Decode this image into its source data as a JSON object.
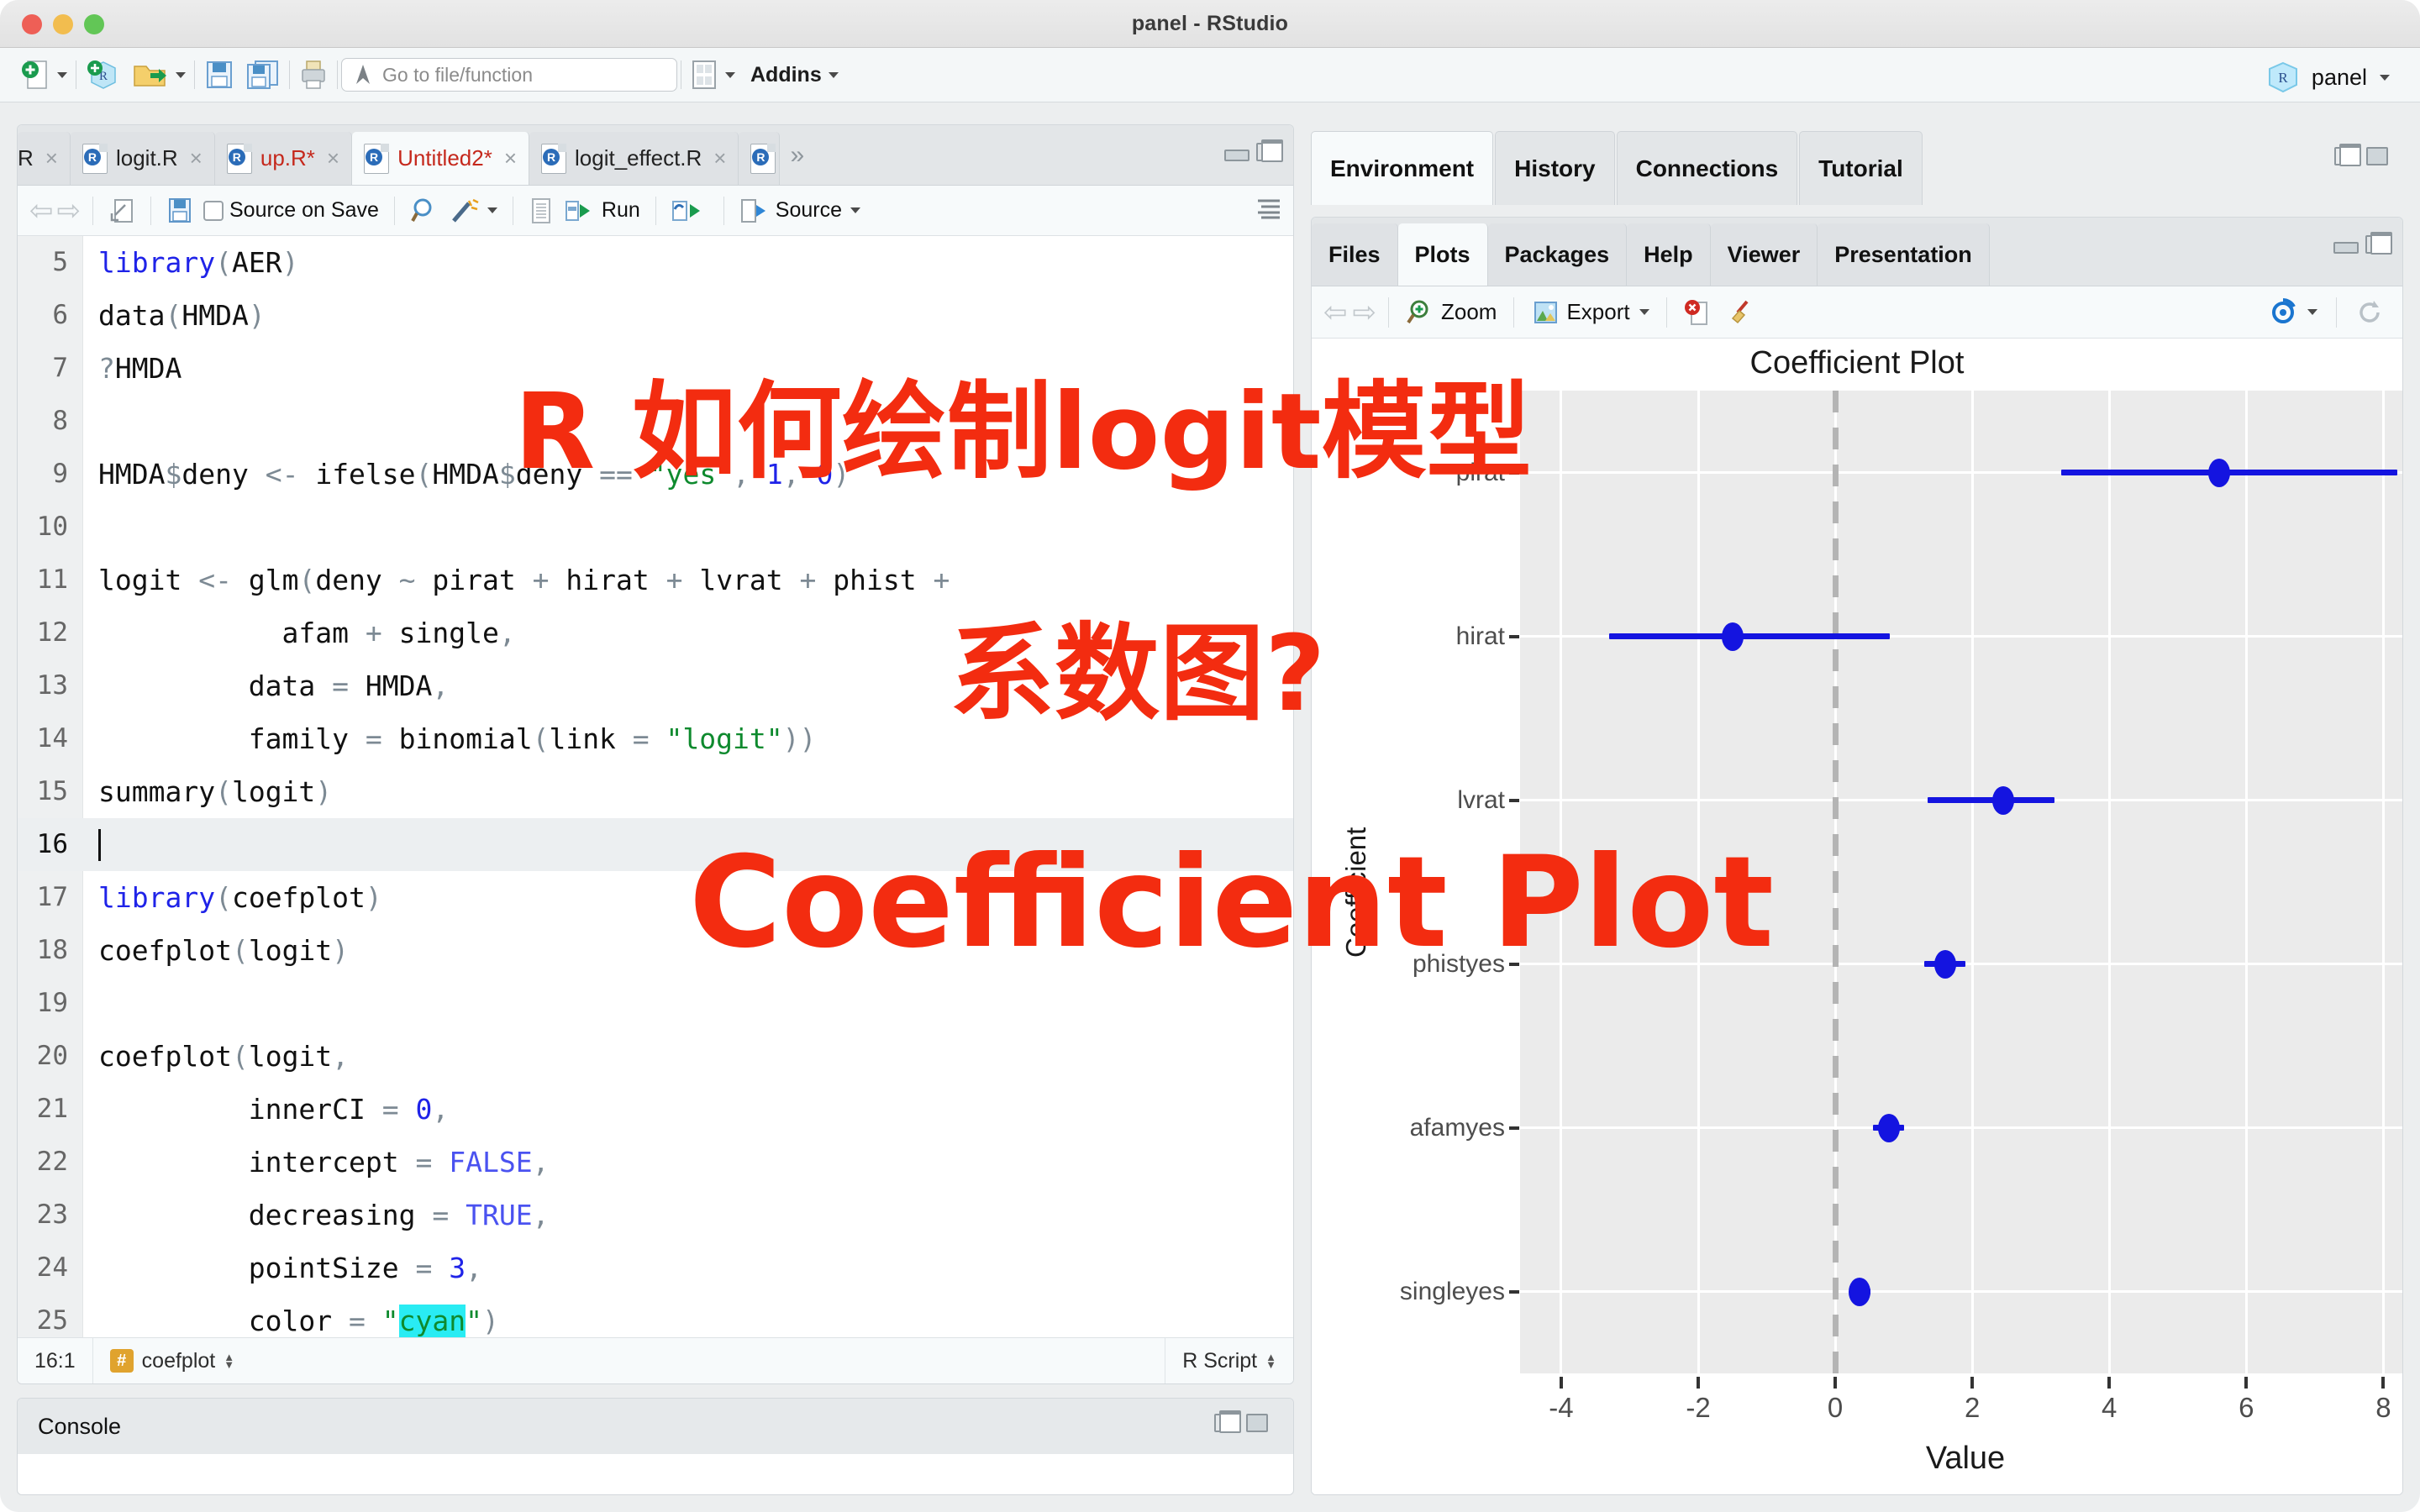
{
  "window": {
    "title": "panel - RStudio"
  },
  "toolbar": {
    "goto_placeholder": "Go to file/function",
    "addins_label": "Addins",
    "project_name": "panel"
  },
  "source_pane": {
    "tabs": [
      {
        "label": "R",
        "dirty": false,
        "active": false,
        "truncated": true
      },
      {
        "label": "logit.R",
        "dirty": false,
        "active": false
      },
      {
        "label": "up.R*",
        "dirty": true,
        "active": false
      },
      {
        "label": "Untitled2*",
        "dirty": true,
        "active": true
      },
      {
        "label": "logit_effect.R",
        "dirty": false,
        "active": false
      }
    ],
    "overflow_icon": "»",
    "toolbar": {
      "back_icon": "back-arrow-icon",
      "forward_icon": "forward-arrow-icon",
      "popout_icon": "show-in-new-window-icon",
      "save_icon": "save-icon",
      "source_on_save": "Source on Save",
      "find_icon": "magnifier-icon",
      "magic_icon": "code-tools-icon",
      "compile_icon": "compile-report-icon",
      "run_label": "Run",
      "rerun_icon": "re-run-icon",
      "source_label": "Source",
      "outline_icon": "document-outline-icon"
    },
    "status": {
      "cursor": "16:1",
      "scope": "coefplot",
      "file_type": "R Script"
    },
    "code": [
      {
        "n": "5",
        "html": "<span class=\"kw\">library</span><span class=\"par\">(</span>AER<span class=\"par\">)</span>"
      },
      {
        "n": "6",
        "html": "data<span class=\"par\">(</span>HMDA<span class=\"par\">)</span>"
      },
      {
        "n": "7",
        "html": "<span class=\"par\">?</span>HMDA"
      },
      {
        "n": "8",
        "html": ""
      },
      {
        "n": "9",
        "html": "HMDA<span class=\"dollar\">$</span>deny <span class=\"op\">&lt;-</span> ifelse<span class=\"par\">(</span>HMDA<span class=\"dollar\">$</span>deny <span class=\"op\">==</span> <span class=\"str\">\"yes\"</span><span class=\"par\">,</span> <span class=\"num\">1</span><span class=\"par\">,</span> <span class=\"num\">0</span><span class=\"par\">)</span>"
      },
      {
        "n": "10",
        "html": ""
      },
      {
        "n": "11",
        "html": "logit <span class=\"op\">&lt;-</span> glm<span class=\"par\">(</span>deny <span class=\"op\">~</span> pirat <span class=\"op\">+</span> hirat <span class=\"op\">+</span> lvrat <span class=\"op\">+</span> phist <span class=\"op\">+</span>"
      },
      {
        "n": "12",
        "html": "           afam <span class=\"op\">+</span> single<span class=\"par\">,</span>"
      },
      {
        "n": "13",
        "html": "         data <span class=\"op\">=</span> HMDA<span class=\"par\">,</span>"
      },
      {
        "n": "14",
        "html": "         family <span class=\"op\">=</span> binomial<span class=\"par\">(</span>link <span class=\"op\">=</span> <span class=\"str\">\"logit\"</span><span class=\"par\">))</span>"
      },
      {
        "n": "15",
        "html": "summary<span class=\"par\">(</span>logit<span class=\"par\">)</span>"
      },
      {
        "n": "16",
        "html": "<span class=\"caret-bar\"></span>",
        "current": true
      },
      {
        "n": "17",
        "html": "<span class=\"kw\">library</span><span class=\"par\">(</span>coefplot<span class=\"par\">)</span>"
      },
      {
        "n": "18",
        "html": "coefplot<span class=\"par\">(</span>logit<span class=\"par\">)</span>"
      },
      {
        "n": "19",
        "html": ""
      },
      {
        "n": "20",
        "html": "coefplot<span class=\"par\">(</span>logit<span class=\"par\">,</span>"
      },
      {
        "n": "21",
        "html": "         innerCI <span class=\"op\">=</span> <span class=\"num\">0</span><span class=\"par\">,</span>"
      },
      {
        "n": "22",
        "html": "         intercept <span class=\"op\">=</span> <span class=\"bool\">FALSE</span><span class=\"par\">,</span>"
      },
      {
        "n": "23",
        "html": "         decreasing <span class=\"op\">=</span> <span class=\"bool\">TRUE</span><span class=\"par\">,</span>"
      },
      {
        "n": "24",
        "html": "         pointSize <span class=\"op\">=</span> <span class=\"num\">3</span><span class=\"par\">,</span>"
      },
      {
        "n": "25",
        "html": "         color <span class=\"op\">=</span> <span class=\"str\">\"</span><span class=\"hl\">cyan</span><span class=\"str\">\"</span><span class=\"par\">)</span>"
      }
    ]
  },
  "console_pane": {
    "title": "Console"
  },
  "env_pane": {
    "tabs": [
      {
        "label": "Environment",
        "active": true
      },
      {
        "label": "History",
        "active": false
      },
      {
        "label": "Connections",
        "active": false
      },
      {
        "label": "Tutorial",
        "active": false
      }
    ]
  },
  "plot_pane": {
    "tabs": [
      {
        "label": "Files",
        "active": false
      },
      {
        "label": "Plots",
        "active": true
      },
      {
        "label": "Packages",
        "active": false
      },
      {
        "label": "Help",
        "active": false
      },
      {
        "label": "Viewer",
        "active": false
      },
      {
        "label": "Presentation",
        "active": false
      }
    ],
    "toolbar": {
      "prev_icon": "back-arrow-icon",
      "next_icon": "forward-arrow-icon",
      "zoom_label": "Zoom",
      "export_label": "Export",
      "remove_icon": "remove-plot-icon",
      "clear_icon": "clear-all-plots-icon",
      "publish_icon": "publish-icon",
      "refresh_icon": "refresh-icon"
    }
  },
  "annotations": [
    {
      "text": "R 如何绘制logit模型",
      "color": "#f32c10"
    },
    {
      "text": "系数图?",
      "color": "#f32c10"
    },
    {
      "text": "Coefficient Plot",
      "color": "#f32c10"
    }
  ],
  "chart_data": {
    "type": "scatter",
    "subtype": "coefficient-dot-and-whisker",
    "title": "Coefficient Plot",
    "xlabel": "Value",
    "ylabel": "Coefficient",
    "xlim": [
      -4.6,
      8.4
    ],
    "xticks": [
      -4,
      -2,
      0,
      2,
      4,
      6,
      8
    ],
    "xtick_labels": [
      "-4",
      "-2",
      "0",
      "2",
      "4",
      "6",
      "8"
    ],
    "categories": [
      "pirat",
      "hirat",
      "lvrat",
      "phistyes",
      "afamyes",
      "singleyes"
    ],
    "reference_line": 0,
    "reference_line_style": "dashed",
    "point_color": "#1414e0",
    "panel_background": "#ebebeb",
    "grid": true,
    "legend": "none",
    "points": [
      {
        "label": "pirat",
        "value": 5.6,
        "ci_low": 3.3,
        "ci_high": 8.2
      },
      {
        "label": "hirat",
        "value": -1.5,
        "ci_low": -3.3,
        "ci_high": 0.8
      },
      {
        "label": "lvrat",
        "value": 2.45,
        "ci_low": 1.35,
        "ci_high": 3.2
      },
      {
        "label": "phistyes",
        "value": 1.6,
        "ci_low": 1.3,
        "ci_high": 1.9
      },
      {
        "label": "afamyes",
        "value": 0.78,
        "ci_low": 0.55,
        "ci_high": 1.0
      },
      {
        "label": "singleyes",
        "value": 0.36,
        "ci_low": 0.22,
        "ci_high": 0.52
      }
    ]
  }
}
